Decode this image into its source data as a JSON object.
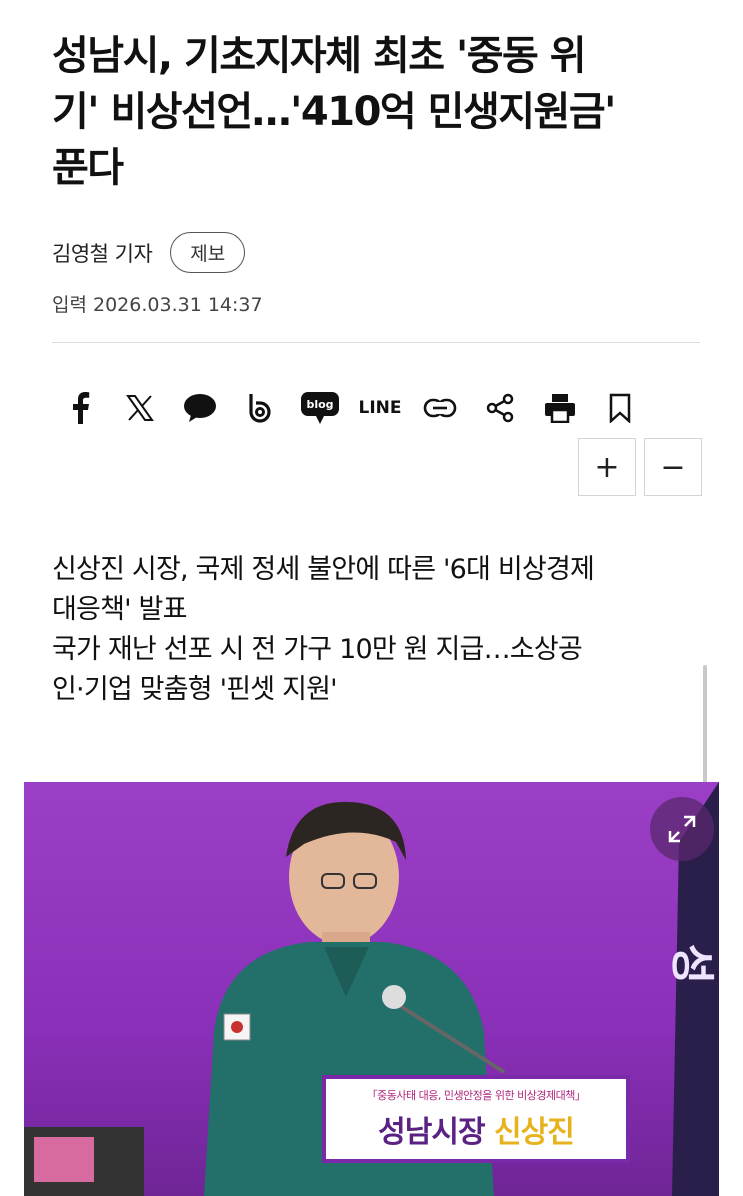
{
  "article": {
    "headline_line1": "성남시, 기초지자체 최초 '중동 위",
    "headline_line2": "기' 비상선언…'410억 민생지원금'",
    "headline_line3": "푼다",
    "author": "김영철 기자",
    "tip_button": "제보",
    "date": "입력 2026.03.31 14:37"
  },
  "share_bar": {
    "icons": [
      "facebook-icon",
      "x-icon",
      "kakaotalk-icon",
      "band-icon",
      "blog-icon",
      "line-icon",
      "link-icon",
      "share-icon",
      "print-icon",
      "bookmark-icon"
    ],
    "blog_label": "blog",
    "line_label": "LINE"
  },
  "text_size": {
    "increase": "+",
    "decrease": "−"
  },
  "summary": {
    "line1": "신상진 시장, 국제 정세 불안에 따른 '6대 비상경제",
    "line2": "대응책' 발표",
    "line3": "국가 재난 선포 시 전 가구 10만 원 지급…소상공",
    "line4": "인·기업 맞춤형 '핀셋 지원'"
  },
  "photo": {
    "board_subtitle": "「중동사태 대응, 민생안정을 위한 비상경제대책」",
    "board_title_prefix": "성남시장 ",
    "board_title_name": "신상진",
    "flag_text": "성"
  },
  "colors": {
    "accent": "#8a2fb8",
    "board_name": "#e7b21c"
  }
}
